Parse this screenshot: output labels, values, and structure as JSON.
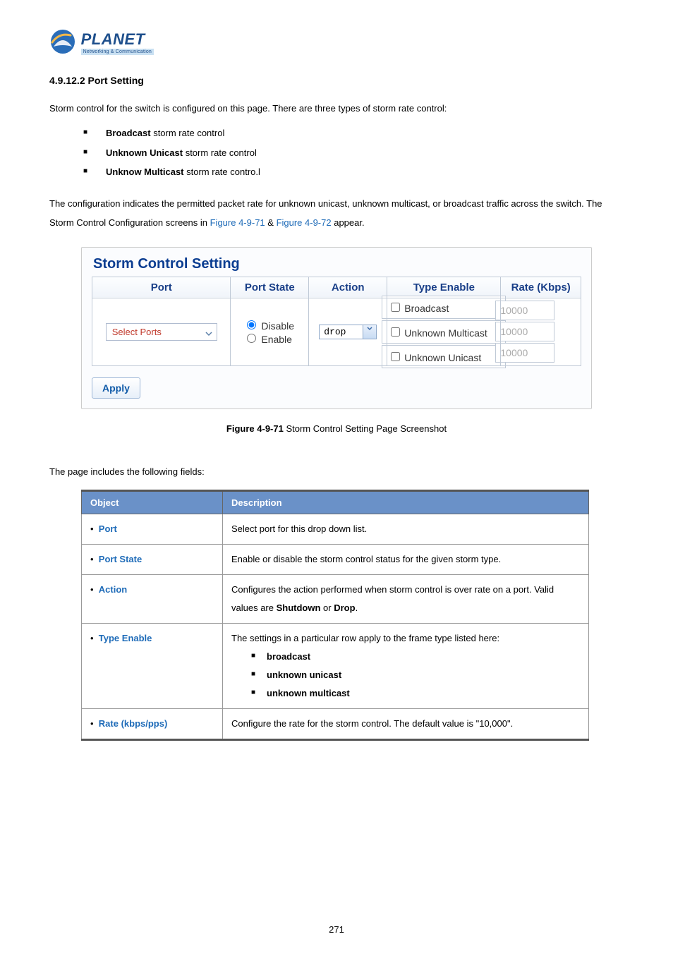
{
  "logo": {
    "brand": "PLANET",
    "tagline": "Networking & Communication"
  },
  "section": {
    "number": "4.9.12.2",
    "title": "Port Setting"
  },
  "intro": "Storm control for the switch is configured on this page. There are three types of storm rate control:",
  "types": {
    "b1_bold": "Broadcast",
    "b1_rest": " storm rate control",
    "b2_bold": "Unknown Unicast",
    "b2_rest": " storm rate control",
    "b3_bold": "Unknow Multicast",
    "b3_rest": " storm rate contro.l"
  },
  "config_para": {
    "p1": "The configuration indicates the permitted packet rate for unknown unicast, unknown multicast, or broadcast traffic across the switch. The Storm Control Configuration screens in ",
    "f1": "Figure 4-9-71",
    "amp": " & ",
    "f2": "Figure 4-9-72",
    "p2": " appear."
  },
  "panel": {
    "title": "Storm Control Setting",
    "headers": {
      "port": "Port",
      "state": "Port State",
      "action": "Action",
      "type": "Type Enable",
      "rate": "Rate (Kbps)"
    },
    "port_select": "Select Ports",
    "state_disable": "Disable",
    "state_enable": "Enable",
    "action_value": "drop",
    "type_opts": {
      "broadcast": "Broadcast",
      "um": "Unknown Multicast",
      "uu": "Unknown Unicast"
    },
    "rate_values": {
      "r1": "10000",
      "r2": "10000",
      "r3": "10000"
    },
    "apply": "Apply"
  },
  "figure": {
    "bold": "Figure 4-9-71",
    "rest": " Storm Control Setting Page Screenshot"
  },
  "fields_intro": "The page includes the following fields:",
  "desc_table": {
    "h1": "Object",
    "h2": "Description",
    "rows": [
      {
        "obj": "Port",
        "desc": "Select port for this drop down list."
      },
      {
        "obj": "Port State",
        "desc": "Enable or disable the storm control status for the given storm type."
      },
      {
        "obj": "Action",
        "desc_pre": "Configures the action performed when storm control is over rate on a port. Valid values are ",
        "b1": "Shutdown",
        "mid": " or ",
        "b2": "Drop",
        "suf": "."
      },
      {
        "obj": "Type Enable",
        "desc": "The settings in a particular row apply to the frame type listed here:",
        "sub": [
          "broadcast",
          "unknown unicast",
          "unknown multicast"
        ]
      },
      {
        "obj": "Rate (kbps/pps)",
        "desc": "Configure the rate for the storm control. The default value is \"10,000\"."
      }
    ]
  },
  "page_number": "271"
}
